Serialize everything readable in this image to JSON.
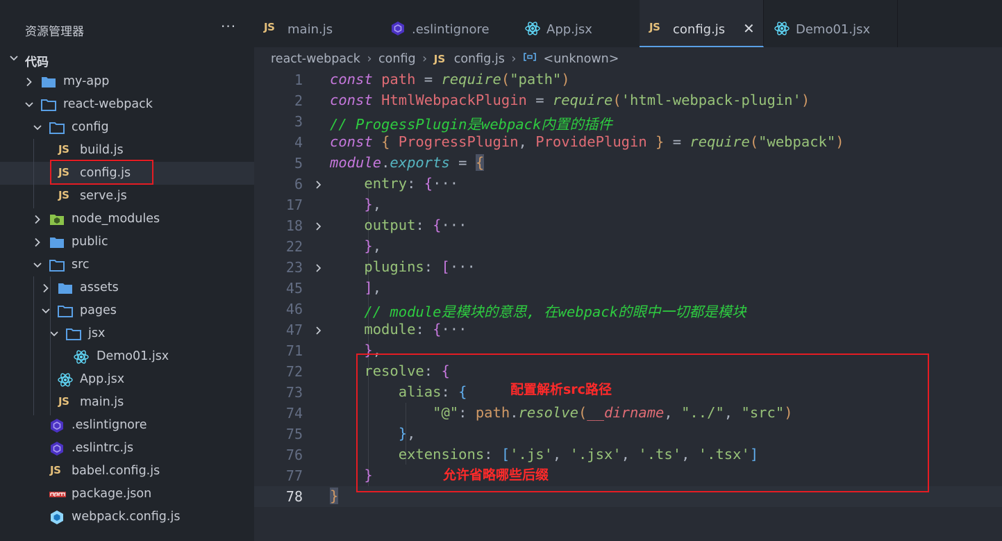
{
  "explorer": {
    "title": "资源管理器",
    "more": "···",
    "workspace": "代码"
  },
  "tree": [
    {
      "label": "my-app",
      "type": "folder",
      "depth": 0,
      "expanded": false
    },
    {
      "label": "react-webpack",
      "type": "folder",
      "depth": 0,
      "expanded": true
    },
    {
      "label": "config",
      "type": "folder",
      "depth": 1,
      "expanded": true
    },
    {
      "label": "build.js",
      "type": "js",
      "depth": 2
    },
    {
      "label": "config.js",
      "type": "js",
      "depth": 2,
      "selected": true
    },
    {
      "label": "serve.js",
      "type": "js",
      "depth": 2
    },
    {
      "label": "node_modules",
      "type": "node-folder",
      "depth": 1,
      "expanded": false
    },
    {
      "label": "public",
      "type": "folder",
      "depth": 1,
      "expanded": false
    },
    {
      "label": "src",
      "type": "folder",
      "depth": 1,
      "expanded": true
    },
    {
      "label": "assets",
      "type": "folder",
      "depth": 2,
      "expanded": false
    },
    {
      "label": "pages",
      "type": "folder",
      "depth": 2,
      "expanded": true
    },
    {
      "label": "jsx",
      "type": "folder",
      "depth": 3,
      "expanded": true
    },
    {
      "label": "Demo01.jsx",
      "type": "react",
      "depth": 4
    },
    {
      "label": "App.jsx",
      "type": "react",
      "depth": 2
    },
    {
      "label": "main.js",
      "type": "js",
      "depth": 2
    },
    {
      "label": ".eslintignore",
      "type": "eslint",
      "depth": 1
    },
    {
      "label": ".eslintrc.js",
      "type": "eslint",
      "depth": 1
    },
    {
      "label": "babel.config.js",
      "type": "js",
      "depth": 1
    },
    {
      "label": "package.json",
      "type": "npm",
      "depth": 1
    },
    {
      "label": "webpack.config.js",
      "type": "webpack",
      "depth": 1
    }
  ],
  "tabs": [
    {
      "label": "main.js",
      "type": "js"
    },
    {
      "label": ".eslintignore",
      "type": "eslint"
    },
    {
      "label": "App.jsx",
      "type": "react"
    },
    {
      "label": "config.js",
      "type": "js",
      "active": true,
      "close": "✕"
    },
    {
      "label": "Demo01.jsx",
      "type": "react"
    }
  ],
  "breadcrumb": {
    "root": "react-webpack",
    "folder": "config",
    "file_badge": "JS",
    "file": "config.js",
    "symbol": "<unknown>",
    "sep": "›"
  },
  "js_badge": "JS",
  "code": {
    "lines": [
      {
        "n": "1"
      },
      {
        "n": "2"
      },
      {
        "n": "3"
      },
      {
        "n": "4"
      },
      {
        "n": "5"
      },
      {
        "n": "6",
        "fold": true
      },
      {
        "n": "17"
      },
      {
        "n": "18",
        "fold": true
      },
      {
        "n": "22"
      },
      {
        "n": "23",
        "fold": true
      },
      {
        "n": "45"
      },
      {
        "n": "46"
      },
      {
        "n": "47",
        "fold": true
      },
      {
        "n": "71"
      },
      {
        "n": "72"
      },
      {
        "n": "73"
      },
      {
        "n": "74"
      },
      {
        "n": "75"
      },
      {
        "n": "76"
      },
      {
        "n": "77"
      },
      {
        "n": "78"
      }
    ],
    "t": {
      "const": "const",
      "path": "path",
      "eq": " = ",
      "require": "require",
      "s_path": "\"path\"",
      "HtmlWebpackPlugin": "HtmlWebpackPlugin",
      "s_html": "'html-webpack-plugin'",
      "c3": "// ProgessPlugin是webpack内置的插件",
      "ProgressPlugin": "ProgressPlugin",
      "ProvidePlugin": "ProvidePlugin",
      "s_webpack": "\"webpack\"",
      "module": "module",
      "exports": "exports",
      "entry": "entry",
      "output": "output",
      "plugins": "plugins",
      "c46": "// module是模块的意思, 在webpack的眼中一切都是模块",
      "resolve": "resolve",
      "alias": "alias",
      "s_at": "\"@\"",
      "dirname": "__dirname",
      "s_up": "\"../\"",
      "s_src": "\"src\"",
      "extensions": "extensions",
      "s_js": "'.js'",
      "s_jsx": "'.jsx'",
      "s_ts": "'.ts'",
      "s_tsx": "'.tsx'",
      "ellipsis": "···"
    }
  },
  "annotations": {
    "alias_note": "配置解析src路径",
    "ext_note": "允许省略哪些后缀"
  },
  "colors": {
    "accent": "#5aa0e6",
    "highlight_box": "#e51c23",
    "annotation_text": "#ff2a2a"
  }
}
